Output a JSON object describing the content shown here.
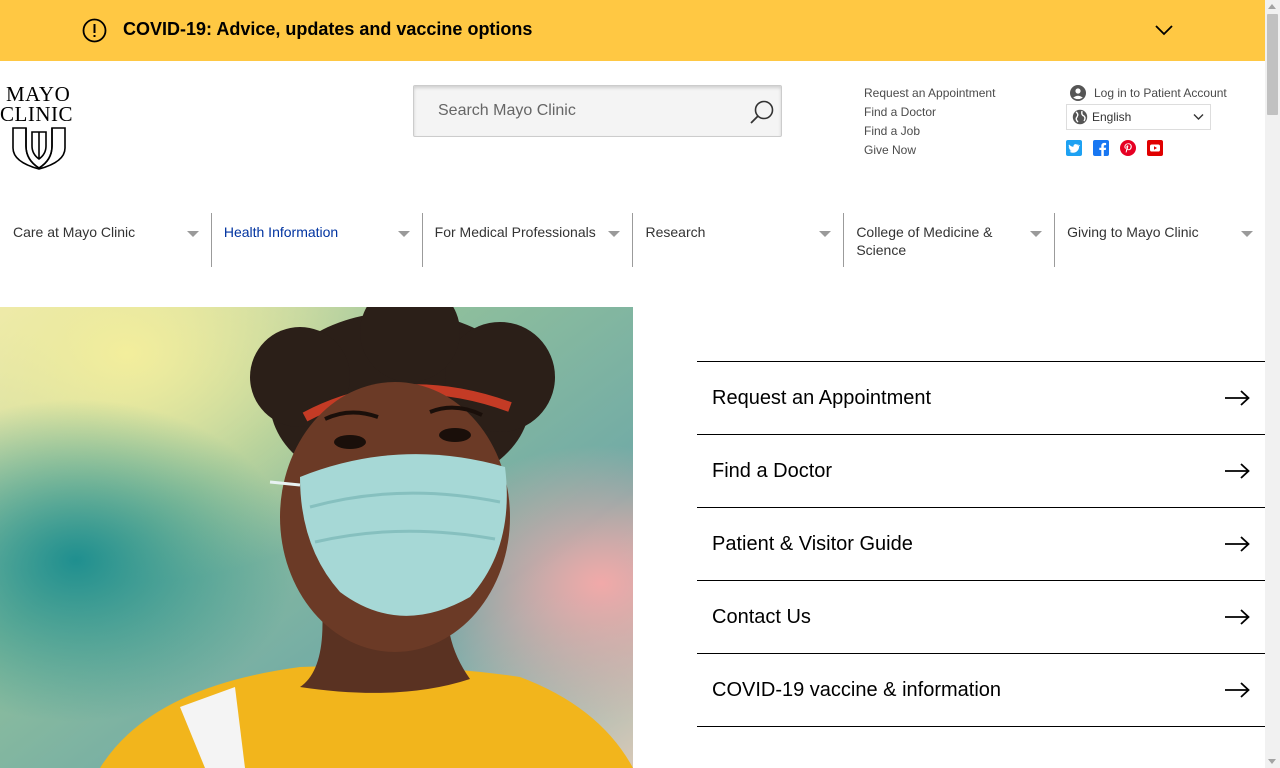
{
  "alert": {
    "text": "COVID-19: Advice, updates and vaccine options",
    "icon": "exclamation-circle-icon",
    "color": "#ffc843"
  },
  "logo": {
    "line1": "MAYO",
    "line2": "CLINIC"
  },
  "search": {
    "placeholder": "Search Mayo Clinic",
    "value": ""
  },
  "util_links": [
    "Request an Appointment",
    "Find a Doctor",
    "Find a Job",
    "Give Now"
  ],
  "account": {
    "login_label": "Log in to Patient Account",
    "language": "English"
  },
  "social": [
    {
      "name": "twitter-icon",
      "color": "#1da1f2"
    },
    {
      "name": "facebook-icon",
      "color": "#1877f2"
    },
    {
      "name": "pinterest-icon",
      "color": "#e60023"
    },
    {
      "name": "youtube-icon",
      "color": "#e00000"
    }
  ],
  "nav": {
    "items": [
      {
        "label": "Care at Mayo Clinic",
        "active": false
      },
      {
        "label": "Health Information",
        "active": true
      },
      {
        "label": "For Medical Professionals",
        "active": false
      },
      {
        "label": "Research",
        "active": false
      },
      {
        "label": "College of Medicine & Science",
        "active": false
      },
      {
        "label": "Giving to Mayo Clinic",
        "active": false
      }
    ],
    "active_color": "#0033a0"
  },
  "quick_links": [
    "Request an Appointment",
    "Find a Doctor",
    "Patient & Visitor Guide",
    "Contact Us",
    "COVID-19 vaccine & information"
  ]
}
